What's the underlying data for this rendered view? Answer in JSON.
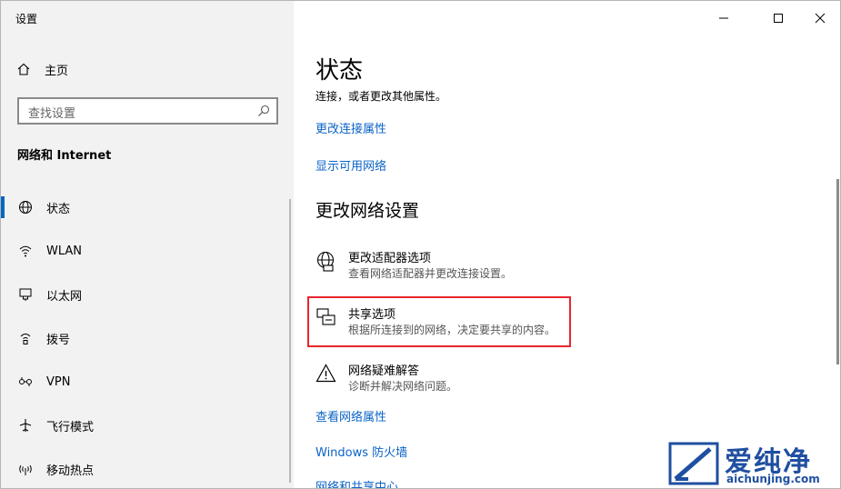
{
  "window": {
    "title": "设置",
    "controls": {
      "minimize": "—",
      "maximize": "☐",
      "close": "✕"
    }
  },
  "sidebar": {
    "home_label": "主页",
    "search_placeholder": "查找设置",
    "section_title": "网络和 Internet",
    "items": [
      {
        "label": "状态",
        "icon": "globe-icon",
        "active": true
      },
      {
        "label": "WLAN",
        "icon": "wifi-icon",
        "active": false
      },
      {
        "label": "以太网",
        "icon": "ethernet-icon",
        "active": false
      },
      {
        "label": "拨号",
        "icon": "dialup-icon",
        "active": false
      },
      {
        "label": "VPN",
        "icon": "vpn-icon",
        "active": false
      },
      {
        "label": "飞行模式",
        "icon": "airplane-icon",
        "active": false
      },
      {
        "label": "移动热点",
        "icon": "hotspot-icon",
        "active": false
      }
    ]
  },
  "main": {
    "title": "状态",
    "subtitle": "连接，或者更改其他属性。",
    "links_top": [
      "更改连接属性",
      "显示可用网络"
    ],
    "section_title": "更改网络设置",
    "options": [
      {
        "title": "更改适配器选项",
        "desc": "查看网络适配器并更改连接设置。",
        "icon": "adapter-icon"
      },
      {
        "title": "共享选项",
        "desc": "根据所连接到的网络，决定要共享的内容。",
        "icon": "sharing-icon"
      },
      {
        "title": "网络疑难解答",
        "desc": "诊断并解决网络问题。",
        "icon": "warning-icon"
      }
    ],
    "links_bottom": [
      "查看网络属性",
      "Windows 防火墙",
      "网络和共享中心"
    ]
  },
  "watermark": {
    "title": "爱纯净",
    "url": "aichunjing.com"
  },
  "colors": {
    "accent": "#0067c0",
    "link": "#0b63c7",
    "highlight": "#e8262c",
    "sidebar_bg": "#f2f2f2"
  }
}
